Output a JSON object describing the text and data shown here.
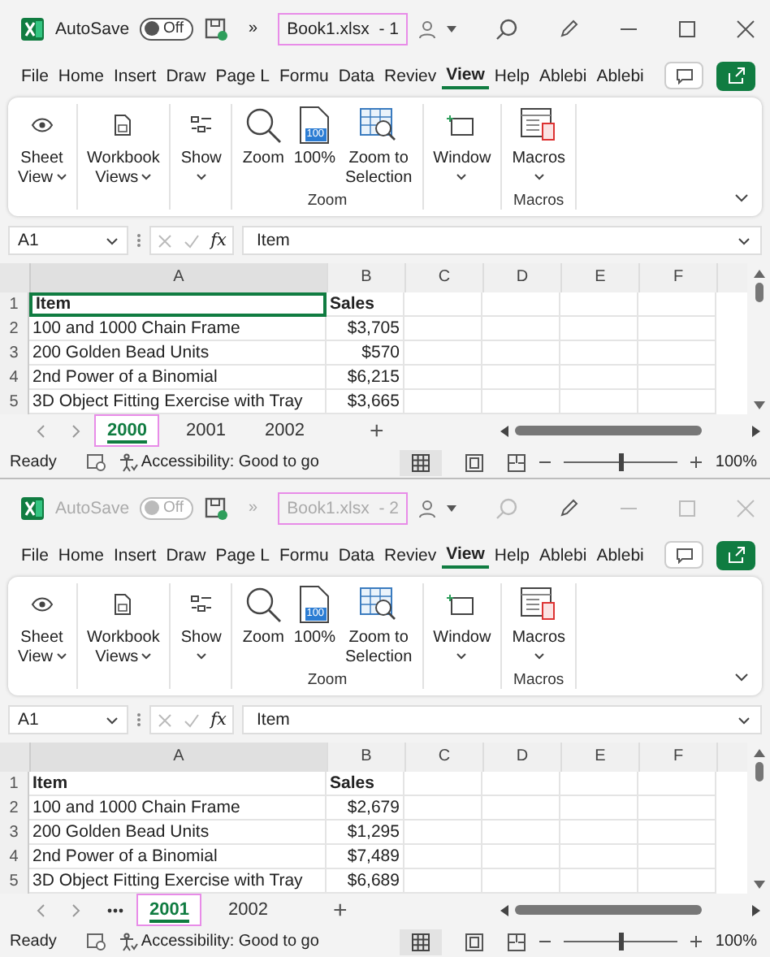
{
  "windows": [
    {
      "active": true,
      "autosave": {
        "label": "AutoSave",
        "toggle": "Off",
        "on": false
      },
      "overflow": "»",
      "title": {
        "text": "Book1.xlsx  - 1",
        "highlighted": true
      },
      "menu_tabs": [
        {
          "label": "File",
          "selected": false
        },
        {
          "label": "Home",
          "selected": false
        },
        {
          "label": "Insert",
          "selected": false
        },
        {
          "label": "Draw",
          "selected": false
        },
        {
          "label": "Page L",
          "selected": false
        },
        {
          "label": "Formu",
          "selected": false
        },
        {
          "label": "Data",
          "selected": false
        },
        {
          "label": "Reviev",
          "selected": false
        },
        {
          "label": "View",
          "selected": true
        },
        {
          "label": "Help",
          "selected": false
        },
        {
          "label": "Ablebi",
          "selected": false
        },
        {
          "label": "Ablebi",
          "selected": false
        }
      ],
      "ribbon_groups": [
        {
          "items": [
            {
              "lines": [
                "Sheet",
                "View"
              ],
              "kind": "eye"
            }
          ]
        },
        {
          "items": [
            {
              "lines": [
                "Workbook",
                "Views"
              ],
              "kind": "doc"
            }
          ]
        },
        {
          "items": [
            {
              "lines": [
                "Show"
              ],
              "kind": "show"
            }
          ]
        },
        {
          "label": "Zoom",
          "items": [
            {
              "lines": [
                "Zoom"
              ],
              "kind": "zoom"
            },
            {
              "lines": [
                "100%"
              ],
              "kind": "hundred",
              "badge": "100"
            },
            {
              "lines": [
                "Zoom to",
                "Selection"
              ],
              "kind": "zoomsel"
            }
          ]
        },
        {
          "items": [
            {
              "lines": [
                "Window"
              ],
              "kind": "window"
            }
          ]
        },
        {
          "label": "Macros",
          "items": [
            {
              "lines": [
                "Macros"
              ],
              "kind": "macros"
            }
          ]
        }
      ],
      "name_box": "A1",
      "fx": "fx",
      "formula": "Item",
      "columns": [
        "A",
        "B",
        "C",
        "D",
        "E",
        "F"
      ],
      "rows": [
        {
          "number": "1",
          "kind": "header",
          "item": "Item",
          "sales": "Sales"
        },
        {
          "number": "2",
          "kind": "data",
          "item": "100 and 1000 Chain Frame",
          "sales": "$3,705"
        },
        {
          "number": "3",
          "kind": "data",
          "item": "200 Golden Bead Units",
          "sales": "$570"
        },
        {
          "number": "4",
          "kind": "data",
          "item": "2nd Power of a Binomial",
          "sales": "$6,215"
        },
        {
          "number": "5",
          "kind": "data",
          "item": "3D Object Fitting Exercise with Tray",
          "sales": "$3,665"
        }
      ],
      "selection_visible": true,
      "hidden_tabs": false,
      "sheet_tabs": [
        {
          "label": "2000",
          "selected": true,
          "highlighted": true
        },
        {
          "label": "2001",
          "selected": false,
          "highlighted": false
        },
        {
          "label": "2002",
          "selected": false,
          "highlighted": false
        }
      ],
      "add_sheet": "+",
      "status": "Ready",
      "accessibility": "Accessibility: Good to go",
      "zoom": {
        "level": 0.5,
        "reading": "100%"
      }
    },
    {
      "active": false,
      "autosave": {
        "label": "AutoSave",
        "toggle": "Off",
        "on": false
      },
      "overflow": "»",
      "title": {
        "text": "Book1.xlsx  - 2",
        "highlighted": true
      },
      "menu_tabs": [
        {
          "label": "File",
          "selected": false
        },
        {
          "label": "Home",
          "selected": false
        },
        {
          "label": "Insert",
          "selected": false
        },
        {
          "label": "Draw",
          "selected": false
        },
        {
          "label": "Page L",
          "selected": false
        },
        {
          "label": "Formu",
          "selected": false
        },
        {
          "label": "Data",
          "selected": false
        },
        {
          "label": "Reviev",
          "selected": false
        },
        {
          "label": "View",
          "selected": true
        },
        {
          "label": "Help",
          "selected": false
        },
        {
          "label": "Ablebi",
          "selected": false
        },
        {
          "label": "Ablebi",
          "selected": false
        }
      ],
      "ribbon_groups": [
        {
          "items": [
            {
              "lines": [
                "Sheet",
                "View"
              ],
              "kind": "eye"
            }
          ]
        },
        {
          "items": [
            {
              "lines": [
                "Workbook",
                "Views"
              ],
              "kind": "doc"
            }
          ]
        },
        {
          "items": [
            {
              "lines": [
                "Show"
              ],
              "kind": "show"
            }
          ]
        },
        {
          "label": "Zoom",
          "items": [
            {
              "lines": [
                "Zoom"
              ],
              "kind": "zoom"
            },
            {
              "lines": [
                "100%"
              ],
              "kind": "hundred",
              "badge": "100"
            },
            {
              "lines": [
                "Zoom to",
                "Selection"
              ],
              "kind": "zoomsel"
            }
          ]
        },
        {
          "items": [
            {
              "lines": [
                "Window"
              ],
              "kind": "window"
            }
          ]
        },
        {
          "label": "Macros",
          "items": [
            {
              "lines": [
                "Macros"
              ],
              "kind": "macros"
            }
          ]
        }
      ],
      "name_box": "A1",
      "fx": "fx",
      "formula": "Item",
      "columns": [
        "A",
        "B",
        "C",
        "D",
        "E",
        "F"
      ],
      "rows": [
        {
          "number": "1",
          "kind": "header",
          "item": "Item",
          "sales": "Sales"
        },
        {
          "number": "2",
          "kind": "data",
          "item": "100 and 1000 Chain Frame",
          "sales": "$2,679"
        },
        {
          "number": "3",
          "kind": "data",
          "item": "200 Golden Bead Units",
          "sales": "$1,295"
        },
        {
          "number": "4",
          "kind": "data",
          "item": "2nd Power of a Binomial",
          "sales": "$7,489"
        },
        {
          "number": "5",
          "kind": "data",
          "item": "3D Object Fitting Exercise with Tray",
          "sales": "$6,689"
        }
      ],
      "selection_visible": false,
      "hidden_tabs": true,
      "sheet_tabs": [
        {
          "label": "2001",
          "selected": true,
          "highlighted": true
        },
        {
          "label": "2002",
          "selected": false,
          "highlighted": false
        }
      ],
      "add_sheet": "+",
      "status": "Ready",
      "accessibility": "Accessibility: Good to go",
      "zoom": {
        "level": 0.5,
        "reading": "100%"
      }
    }
  ]
}
